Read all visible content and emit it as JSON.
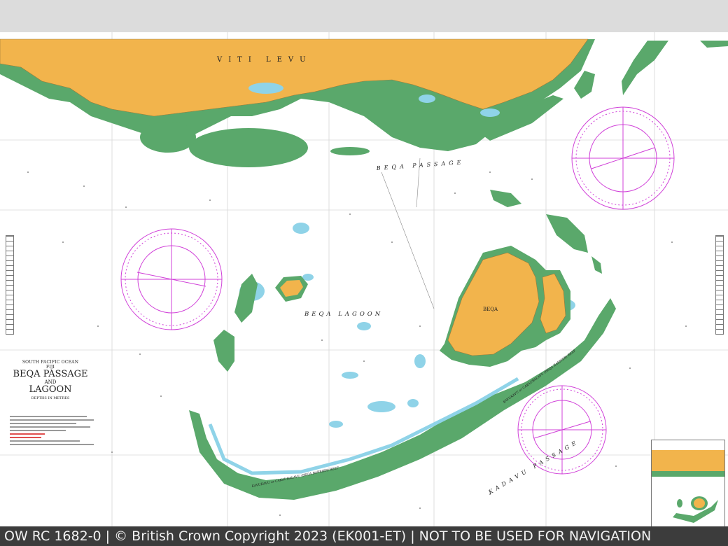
{
  "footer": {
    "text": "OW RC 1682-0 | © British Crown Copyright 2023 (EK001-ET) | NOT TO BE USED FOR NAVIGATION"
  },
  "map": {
    "labels": {
      "viti_levu": "VITI LEVU",
      "beqa_passage": "BEQA PASSAGE",
      "beqa_lagoon": "BEQA LAGOON",
      "beqa": "BEQA",
      "kadavu_passage": "KADAVU PASSAGE",
      "barrier_reef": "KAVUKAVU or CAKAUBALAVU (BEQA BARRIER) REEF",
      "barrier_reef_east": "KAVUKAVU or CAKAUBALAVU (BEQA BARRIER) REEF"
    },
    "title": {
      "ocean": "SOUTH PACIFIC OCEAN",
      "country": "FIJI",
      "line1": "BEQA PASSAGE",
      "line2": "AND",
      "line3": "LAGOON",
      "depths": "DEPTHS IN METRES"
    },
    "colors": {
      "land": "#f2b44c",
      "reef": "#5aa86b",
      "shallow": "#8fd3e8",
      "water": "#ffffff",
      "compass": "#d040d8",
      "footer_bg": "#3c3c3c"
    }
  }
}
